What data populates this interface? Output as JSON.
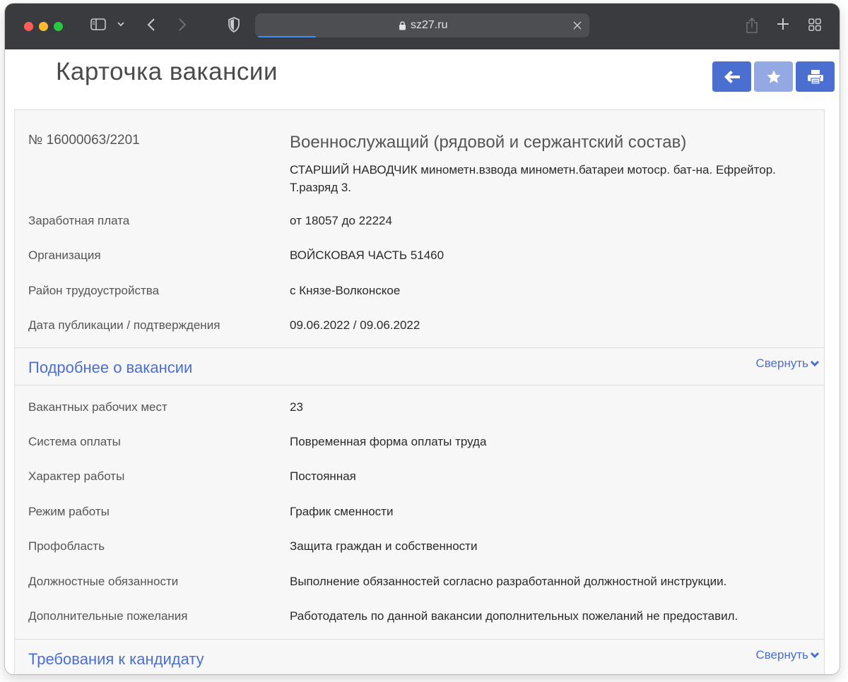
{
  "browser": {
    "url": "sz27.ru"
  },
  "page": {
    "title": "Карточка вакансии"
  },
  "vacancy": {
    "number": "№ 16000063/2201",
    "profession": "Военнослужащий (рядовой и сержантский состав)",
    "position_line1": "СТАРШИЙ НАВОДЧИК минометн.взвода минометн.батареи мотоср. бат-на. Ефрейтор.",
    "position_line2": "Т.разряд 3.",
    "summary": [
      {
        "label": "Заработная плата",
        "value": "от 18057 до 22224"
      },
      {
        "label": "Организация",
        "value": "ВОЙСКОВАЯ ЧАСТЬ 51460"
      },
      {
        "label": "Район трудоустройства",
        "value": "с Князе-Волконское"
      },
      {
        "label": "Дата публикации / подтверждения",
        "value": "09.06.2022 / 09.06.2022"
      }
    ]
  },
  "details_section": {
    "title": "Подробнее о вакансии",
    "toggle_label": "Свернуть",
    "rows": [
      {
        "label": "Вакантных рабочих мест",
        "value": "23"
      },
      {
        "label": "Система оплаты",
        "value": "Повременная форма оплаты труда"
      },
      {
        "label": "Характер работы",
        "value": "Постоянная"
      },
      {
        "label": "Режим работы",
        "value": "График сменности"
      },
      {
        "label": "Профобласть",
        "value": "Защита граждан и собственности"
      },
      {
        "label": "Должностные обязанности",
        "value": "Выполнение обязанностей согласно разработанной должностной инструкции."
      },
      {
        "label": "Дополнительные пожелания",
        "value": "Работодатель по данной вакансии дополнительных пожеланий не предоставил."
      }
    ]
  },
  "requirements_section": {
    "title": "Требования к кандидату",
    "toggle_label": "Свернуть"
  },
  "colors": {
    "accent": "#4a6fd0",
    "accent_disabled": "#94a9e3",
    "toolbar_bg": "#3a3b3f"
  },
  "icons": {
    "back": "arrow-left-icon",
    "favorite": "star-icon",
    "print": "printer-icon"
  }
}
